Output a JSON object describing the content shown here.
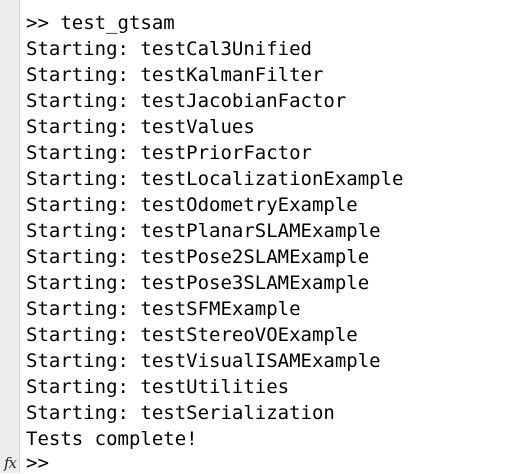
{
  "command_window": {
    "command_line": ">> test_gtsam",
    "output_lines": [
      "Starting: testCal3Unified",
      "Starting: testKalmanFilter",
      "Starting: testJacobianFactor",
      "Starting: testValues",
      "Starting: testPriorFactor",
      "Starting: testLocalizationExample",
      "Starting: testOdometryExample",
      "Starting: testPlanarSLAMExample",
      "Starting: testPose2SLAMExample",
      "Starting: testPose3SLAMExample",
      "Starting: testSFMExample",
      "Starting: testStereoVOExample",
      "Starting: testVisualISAMExample",
      "Starting: testUtilities",
      "Starting: testSerialization"
    ],
    "completion_message": "Tests complete!",
    "prompt_icon_text": "fx",
    "prompt": ">>"
  }
}
